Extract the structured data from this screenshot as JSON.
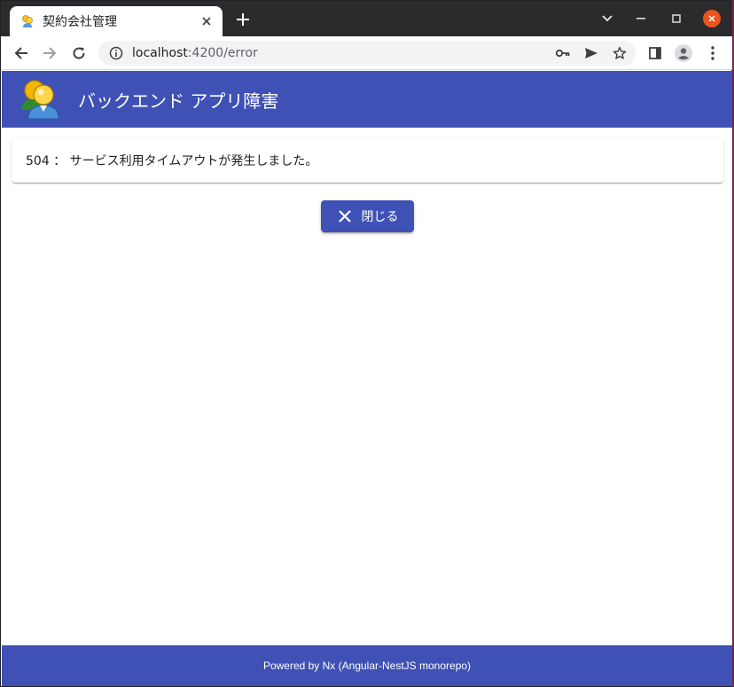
{
  "browser": {
    "tab_title": "契約会社管理",
    "url_host": "localhost",
    "url_path": ":4200/error"
  },
  "icons": {
    "favicon": "people-icon",
    "tab_close": "close-icon",
    "new_tab": "plus-icon",
    "back": "arrow-left-icon",
    "forward": "arrow-right-icon",
    "reload": "reload-icon",
    "site_info": "info-icon",
    "password": "key-icon",
    "share": "send-icon",
    "bookmark": "star-icon",
    "side_panel": "side-panel-icon",
    "profile": "account-icon",
    "menu": "kebab-menu-icon",
    "logo": "users-logo-icon",
    "close_button": "x-icon"
  },
  "app": {
    "title": "バックエンド アプリ障害",
    "error_message": "504 ： サービス利用タイムアウトが発生しました。",
    "close_label": "閉じる",
    "footer": "Powered by Nx (Angular-NestJS monorepo)"
  },
  "colors": {
    "primary": "#3f51b5",
    "chrome_dark": "#2b2b2d",
    "window_close": "#e95420"
  }
}
